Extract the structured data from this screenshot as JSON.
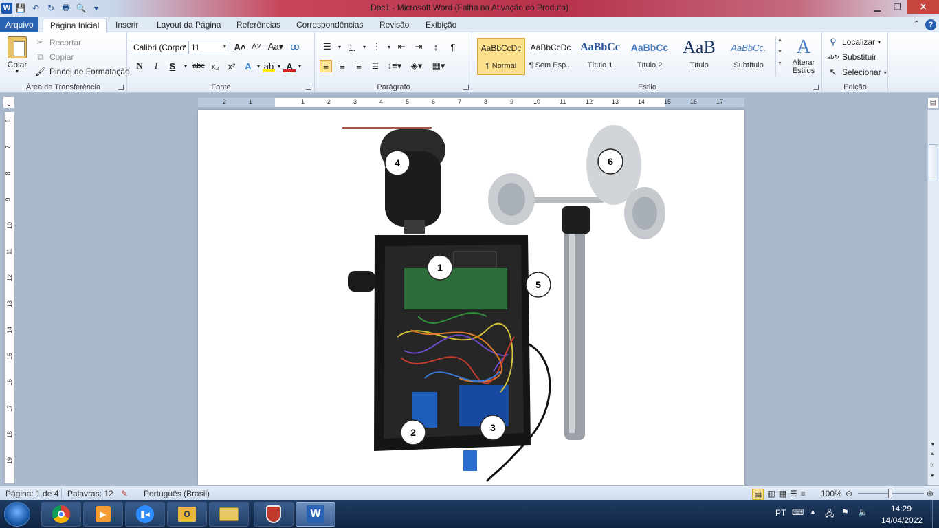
{
  "titlebar": {
    "title": "Doc1  -  Microsoft Word (Falha na Ativação do Produto)",
    "qat_icons": [
      "word-icon",
      "save-icon",
      "undo-icon",
      "redo-icon",
      "print-icon",
      "print-preview-icon",
      "customize-qat-icon"
    ]
  },
  "tabs": {
    "file": "Arquivo",
    "items": [
      "Página Inicial",
      "Inserir",
      "Layout da Página",
      "Referências",
      "Correspondências",
      "Revisão",
      "Exibição"
    ],
    "active": "Página Inicial"
  },
  "clipboard": {
    "paste": "Colar",
    "cut": "Recortar",
    "copy": "Copiar",
    "format_painter": "Pincel de Formatação",
    "label": "Área de Transferência"
  },
  "font": {
    "name": "Calibri (Corpo",
    "size": "11",
    "label": "Fonte",
    "bold": "N",
    "italic": "I",
    "underline": "S",
    "strike": "abc",
    "subscript": "x₂",
    "superscript": "x²"
  },
  "paragraph": {
    "label": "Parágrafo"
  },
  "styles": {
    "label": "Estilo",
    "items": [
      {
        "preview": "AaBbCcDc",
        "name": "¶ Normal"
      },
      {
        "preview": "AaBbCcDc",
        "name": "¶ Sem Esp..."
      },
      {
        "preview": "AaBbCc",
        "name": "Título 1"
      },
      {
        "preview": "AaBbCc",
        "name": "Título 2"
      },
      {
        "preview": "AaB",
        "name": "Título"
      },
      {
        "preview": "AaBbCc.",
        "name": "Subtítulo"
      }
    ],
    "change": "Alterar Estilos"
  },
  "editing": {
    "label": "Edição",
    "find": "Localizar",
    "replace": "Substituir",
    "select": "Selecionar"
  },
  "ruler": {
    "h_numbers": [
      "2",
      "1",
      "1",
      "2",
      "3",
      "4",
      "5",
      "6",
      "7",
      "8",
      "9",
      "10",
      "11",
      "12",
      "13",
      "14",
      "15",
      "16",
      "17"
    ],
    "v_numbers": [
      "6",
      "7",
      "8",
      "9",
      "10",
      "11",
      "12",
      "13",
      "14",
      "15",
      "16",
      "17",
      "18",
      "19"
    ]
  },
  "figure": {
    "callouts": [
      "1",
      "2",
      "3",
      "4",
      "5",
      "6"
    ]
  },
  "statusbar": {
    "page": "Página: 1 de 4",
    "words": "Palavras: 12",
    "language": "Português (Brasil)",
    "zoom": "100%"
  },
  "taskbar": {
    "apps": [
      "chrome-icon",
      "media-player-icon",
      "zoom-icon",
      "outlook-icon",
      "file-explorer-icon",
      "security-shield-icon",
      "word-icon"
    ],
    "lang": "PT",
    "time": "14:29",
    "date": "14/04/2022"
  }
}
